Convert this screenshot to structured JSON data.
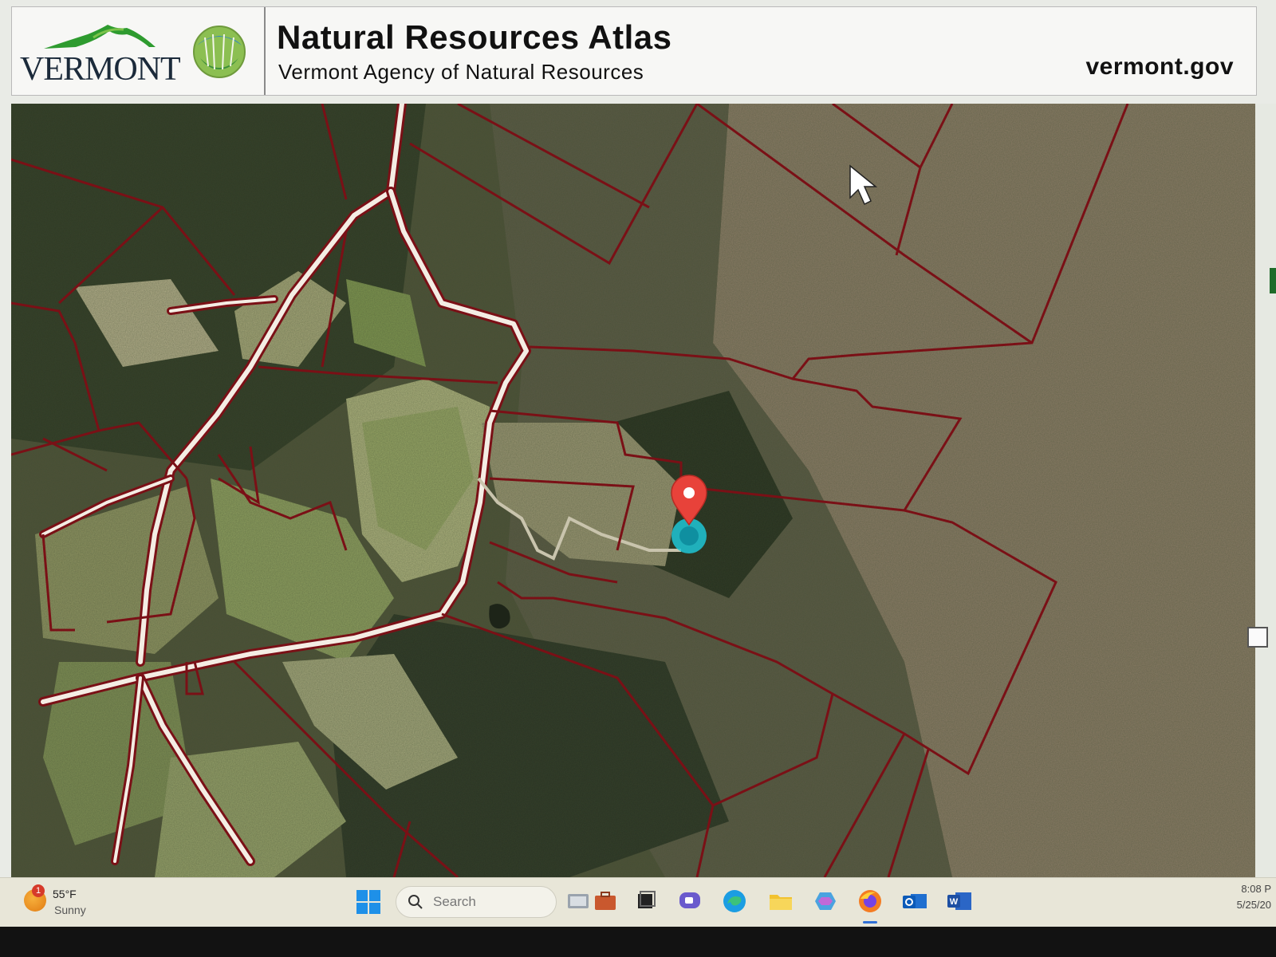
{
  "header": {
    "state_name": "VERMONT",
    "title": "Natural Resources Atlas",
    "subtitle": "Vermont Agency of Natural Resources",
    "site_link": "vermont.gov"
  },
  "taskbar": {
    "weather": {
      "temperature": "55°F",
      "condition": "Sunny",
      "badge": "1"
    },
    "search_placeholder": "Search",
    "clock": {
      "time": "8:08 P",
      "date": "5/25/20"
    },
    "pinned_apps": [
      "start",
      "search",
      "file-viewer",
      "briefcase",
      "task-view",
      "teams",
      "edge",
      "file-explorer",
      "copilot",
      "firefox",
      "outlook",
      "word"
    ]
  },
  "colors": {
    "parcel_line": "#7a1016",
    "road_fill": "#f4ede4",
    "marker": "#e8423a",
    "location_dot": "#1ec5d6",
    "accent_blue": "#2f6fd6"
  }
}
